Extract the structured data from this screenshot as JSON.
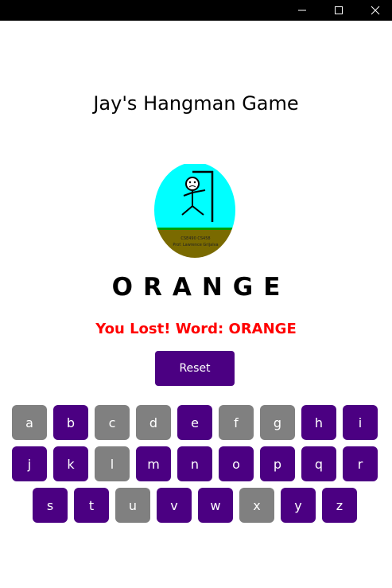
{
  "window": {
    "controls": [
      {
        "name": "minimize-button",
        "icon": "minimize-icon"
      },
      {
        "name": "maximize-button",
        "icon": "maximize-icon"
      },
      {
        "name": "close-button",
        "icon": "close-icon"
      }
    ]
  },
  "app": {
    "title": "Jay's Hangman Game",
    "image_caption_line1": "CSE490 CS458",
    "image_caption_line2": "Prof. Lawrence Grijalva",
    "word": "ORANGE",
    "status": "You Lost! Word: ORANGE",
    "status_color": "#ff0000",
    "reset_label": "Reset"
  },
  "colors": {
    "accent": "#4b0082",
    "used": "#808080"
  },
  "keyboard": {
    "rows": [
      [
        {
          "letter": "a",
          "used": true
        },
        {
          "letter": "b",
          "used": false
        },
        {
          "letter": "c",
          "used": true
        },
        {
          "letter": "d",
          "used": true
        },
        {
          "letter": "e",
          "used": false
        },
        {
          "letter": "f",
          "used": true
        },
        {
          "letter": "g",
          "used": true
        },
        {
          "letter": "h",
          "used": false
        },
        {
          "letter": "i",
          "used": false
        }
      ],
      [
        {
          "letter": "j",
          "used": false
        },
        {
          "letter": "k",
          "used": false
        },
        {
          "letter": "l",
          "used": true
        },
        {
          "letter": "m",
          "used": false
        },
        {
          "letter": "n",
          "used": false
        },
        {
          "letter": "o",
          "used": false
        },
        {
          "letter": "p",
          "used": false
        },
        {
          "letter": "q",
          "used": false
        },
        {
          "letter": "r",
          "used": false
        }
      ],
      [
        {
          "letter": "s",
          "used": false
        },
        {
          "letter": "t",
          "used": false
        },
        {
          "letter": "u",
          "used": true
        },
        {
          "letter": "v",
          "used": false
        },
        {
          "letter": "w",
          "used": false
        },
        {
          "letter": "x",
          "used": true
        },
        {
          "letter": "y",
          "used": false
        },
        {
          "letter": "z",
          "used": false
        }
      ]
    ]
  }
}
